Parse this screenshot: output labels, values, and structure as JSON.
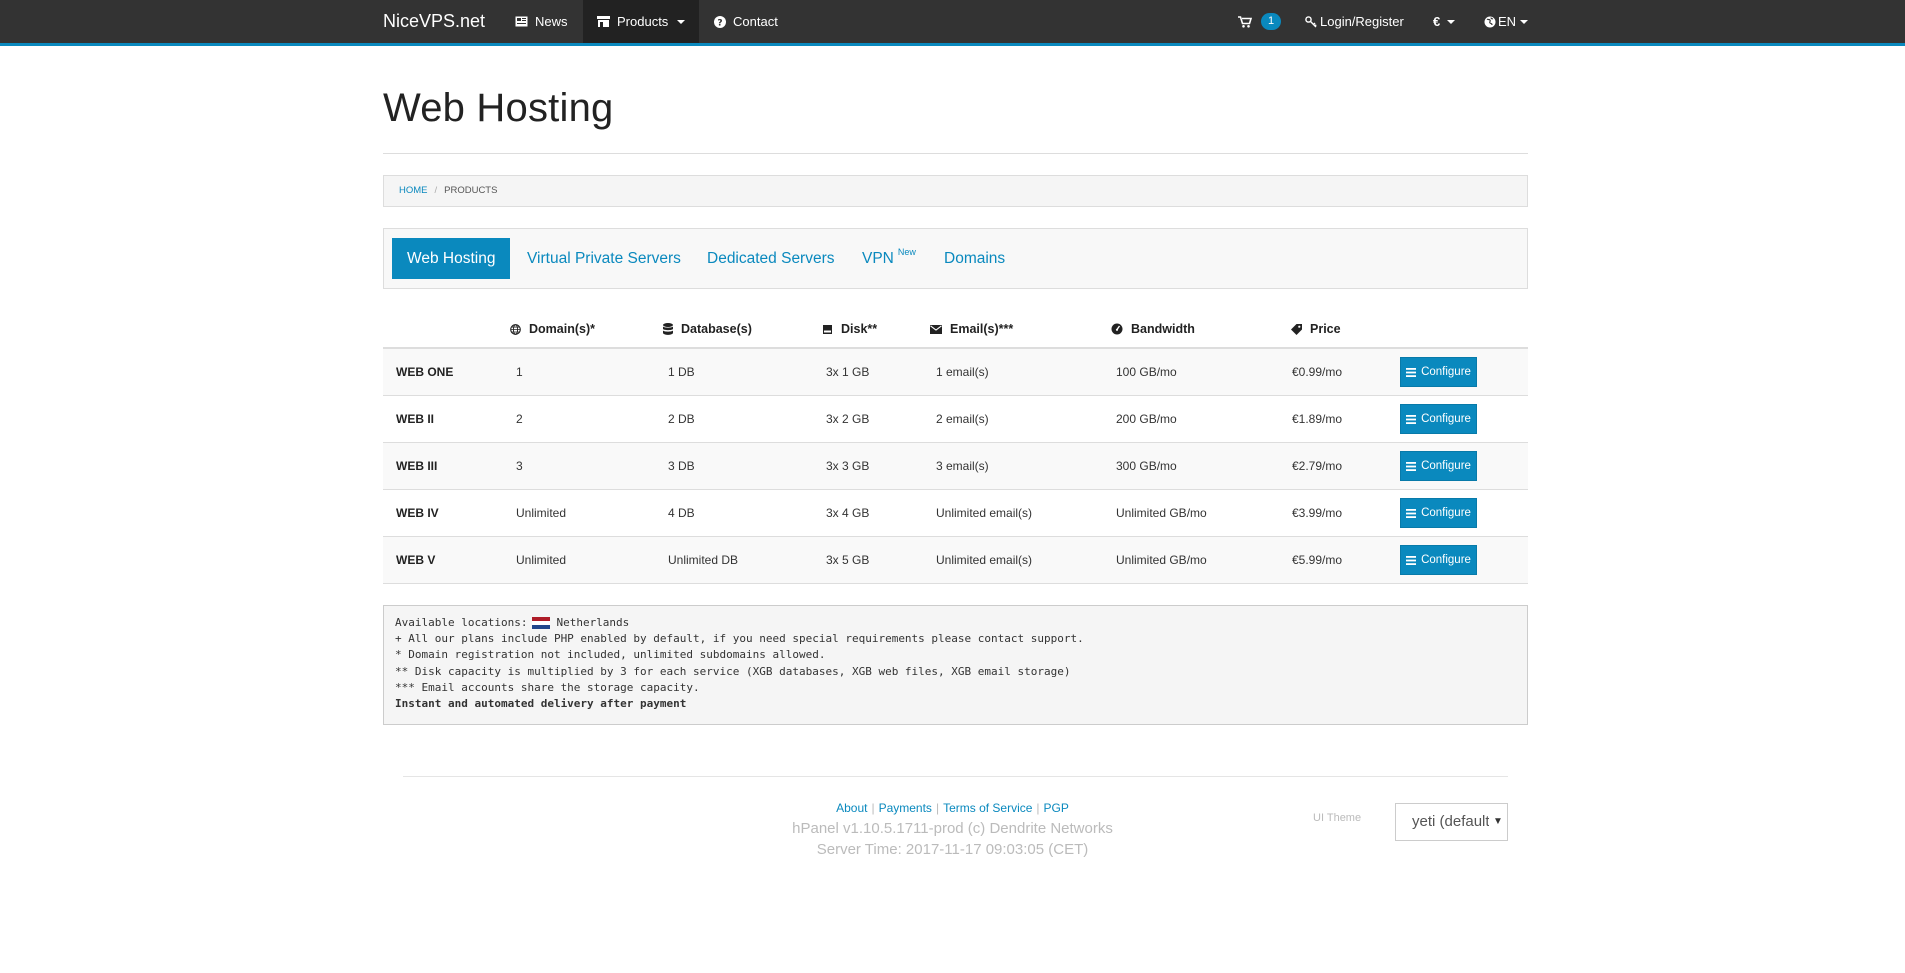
{
  "navbar": {
    "brand": "NiceVPS.net",
    "items": [
      {
        "label": "News",
        "icon": "newspaper-icon"
      },
      {
        "label": "Products",
        "icon": "store-icon",
        "active": true,
        "dropdown": true
      },
      {
        "label": "Contact",
        "icon": "question-circle-icon"
      }
    ],
    "cart_count": "1",
    "login_label": "Login/Register",
    "currency_label": "€",
    "language_label": "EN"
  },
  "page": {
    "title": "Web Hosting"
  },
  "breadcrumb": {
    "home": "HOME",
    "current": "PRODUCTS"
  },
  "tabs": [
    {
      "label": "Web Hosting",
      "active": true
    },
    {
      "label": "Virtual Private Servers"
    },
    {
      "label": "Dedicated Servers"
    },
    {
      "label": "VPN",
      "badge": "New"
    },
    {
      "label": "Domains"
    }
  ],
  "table": {
    "headers": [
      "Domain(s)*",
      "Database(s)",
      "Disk**",
      "Email(s)***",
      "Bandwidth",
      "Price"
    ],
    "rows": [
      {
        "name": "WEB ONE",
        "domains": "1",
        "databases": "1 DB",
        "disk": "3x 1 GB",
        "emails": "1 email(s)",
        "bandwidth": "100 GB/mo",
        "price": "€0.99/mo",
        "action": "Configure"
      },
      {
        "name": "WEB II",
        "domains": "2",
        "databases": "2 DB",
        "disk": "3x 2 GB",
        "emails": "2 email(s)",
        "bandwidth": "200 GB/mo",
        "price": "€1.89/mo",
        "action": "Configure"
      },
      {
        "name": "WEB III",
        "domains": "3",
        "databases": "3 DB",
        "disk": "3x 3 GB",
        "emails": "3 email(s)",
        "bandwidth": "300 GB/mo",
        "price": "€2.79/mo",
        "action": "Configure"
      },
      {
        "name": "WEB IV",
        "domains": "Unlimited",
        "databases": "4 DB",
        "disk": "3x 4 GB",
        "emails": "Unlimited email(s)",
        "bandwidth": "Unlimited GB/mo",
        "price": "€3.99/mo",
        "action": "Configure"
      },
      {
        "name": "WEB V",
        "domains": "Unlimited",
        "databases": "Unlimited DB",
        "disk": "3x 5 GB",
        "emails": "Unlimited email(s)",
        "bandwidth": "Unlimited GB/mo",
        "price": "€5.99/mo",
        "action": "Configure"
      }
    ]
  },
  "info": {
    "locations_label": "Available locations:",
    "location": "Netherlands",
    "lines": [
      "+ All our plans include PHP enabled by default, if you need special requirements please contact support.",
      "* Domain registration not included, unlimited subdomains allowed.",
      "** Disk capacity is multiplied by 3 for each service (XGB databases, XGB web files, XGB email storage)",
      "*** Email accounts share the storage capacity."
    ],
    "delivery": "Instant and automated delivery after payment"
  },
  "footer": {
    "links": [
      "About",
      "Payments",
      "Terms of Service",
      "PGP"
    ],
    "version": "hPanel v1.10.5.1711-prod (c) Dendrite Networks",
    "server_time": "Server Time: 2017-11-17 09:03:05 (CET)",
    "theme_label": "UI Theme",
    "theme_value": "yeti (default)"
  },
  "colors": {
    "navbar": "#333333",
    "accent": "#0a89be",
    "panel": "#f5f5f5"
  }
}
